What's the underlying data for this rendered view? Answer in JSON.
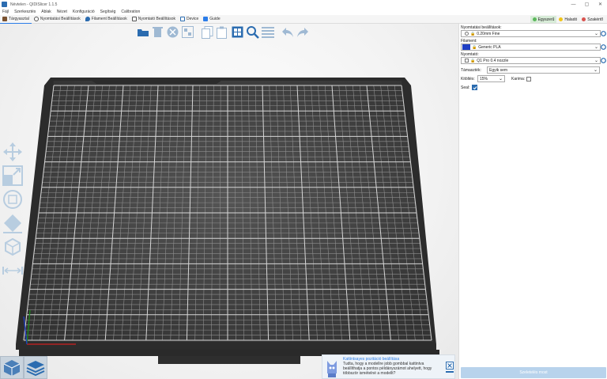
{
  "window": {
    "title": "Névtelen - QIDISlicer 1.1.5",
    "controls": [
      "—",
      "▢",
      "✕"
    ]
  },
  "menu": [
    "Fájl",
    "Szerkesztés",
    "Ablak",
    "Nézet",
    "Konfiguráció",
    "Segítség",
    "Calibration"
  ],
  "tabs": [
    {
      "label": "Tárgyasztal",
      "active": true
    },
    {
      "label": "Nyomtatási Beállítások",
      "active": false
    },
    {
      "label": "Filament Beállítások",
      "active": false
    },
    {
      "label": "Nyomtató Beállítások",
      "active": false
    },
    {
      "label": "Device",
      "active": false
    },
    {
      "label": "Guide",
      "active": false
    }
  ],
  "modes": [
    {
      "label": "Egyszerű",
      "color": "#5cb85c",
      "active": true
    },
    {
      "label": "Haladó",
      "color": "#f0c419",
      "active": false
    },
    {
      "label": "Szakértő",
      "color": "#d9534f",
      "active": false
    }
  ],
  "toolbar_icons": [
    "open-folder-icon",
    "delete-icon",
    "delete-all-icon",
    "arrange-icon",
    "copy-icon",
    "paste-icon",
    "layout-icon",
    "search-icon",
    "layers-list-icon",
    "undo-icon",
    "redo-icon"
  ],
  "left_tools": [
    "move-icon",
    "scale-icon",
    "rotate-icon",
    "place-on-face-icon",
    "cut-icon",
    "measure-icon"
  ],
  "sidebar": {
    "print_settings_label": "Nyomtatási beállítások:",
    "print_settings_value": "0.20mm Fine",
    "filament_label": "Filament:",
    "filament_value": "Generic PLA",
    "filament_color": "#1f3fc4",
    "printer_label": "Nyomtató:",
    "printer_value": "Q1 Pro 0.4 nozzle",
    "supports_label": "Támaszték:",
    "supports_value": "Egyik sem",
    "infill_label": "Kitöltés:",
    "infill_value": "15%",
    "brim_label": "Karima:",
    "seal_label": "Seal:",
    "slice_button": "Szeletelés most"
  },
  "notice": {
    "title": "Kattintsayes pozitáció beállítása",
    "body": "Tudta, hogy a modellre jobb gombbal kattintva beállíthatja a pontos példányszámot ahelyett, hogy többször ismételné a modellt?"
  },
  "colors": {
    "accent": "#2b7de9",
    "bed": "#3a3a3a",
    "grid": "#9a9a9a"
  }
}
